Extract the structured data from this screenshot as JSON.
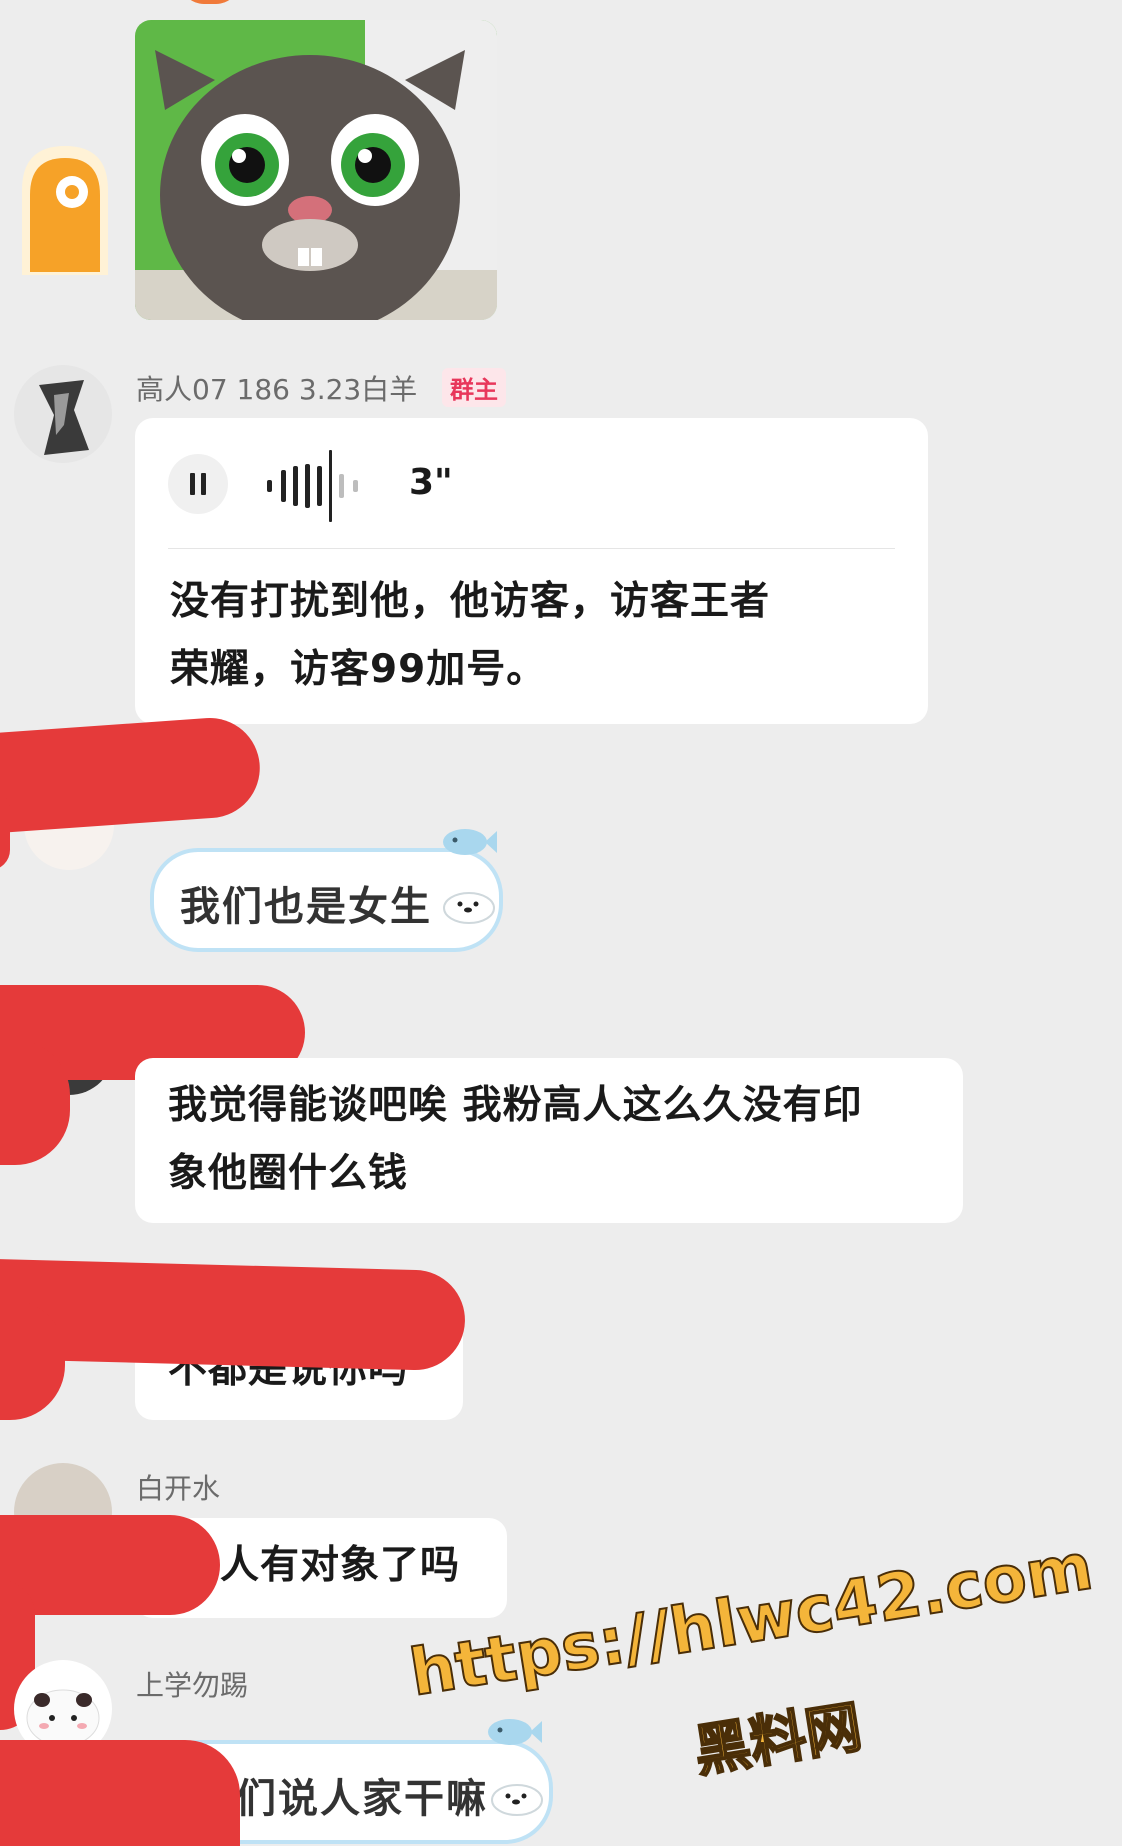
{
  "messages": [
    {
      "sender": "高人07 186 3.23白羊",
      "badge": "群主",
      "voice_duration": "3\"",
      "text_line1": "没有打扰到他，他访客，访客王者",
      "text_line2": "荣耀，访客99加号。"
    },
    {
      "text": "我们也是女生"
    },
    {
      "text_line1": "我觉得能谈吧唉 我粉高人这么久没有印",
      "text_line2": "象他圈什么钱"
    },
    {
      "text": "不都是说你吗"
    },
    {
      "sender": "白开水",
      "text": "人有对象了吗"
    },
    {
      "sender": "上学勿踢",
      "text": "们说人家干嘛"
    }
  ],
  "watermark": {
    "url": "https://hlwc42.com",
    "site": "黑料网"
  },
  "icons": [
    "play-pause-icon",
    "voice-wave-icon"
  ],
  "colors": {
    "accent_badge": "#e8375b",
    "redaction": "#e53a3a",
    "watermark": "#f4b53a"
  }
}
